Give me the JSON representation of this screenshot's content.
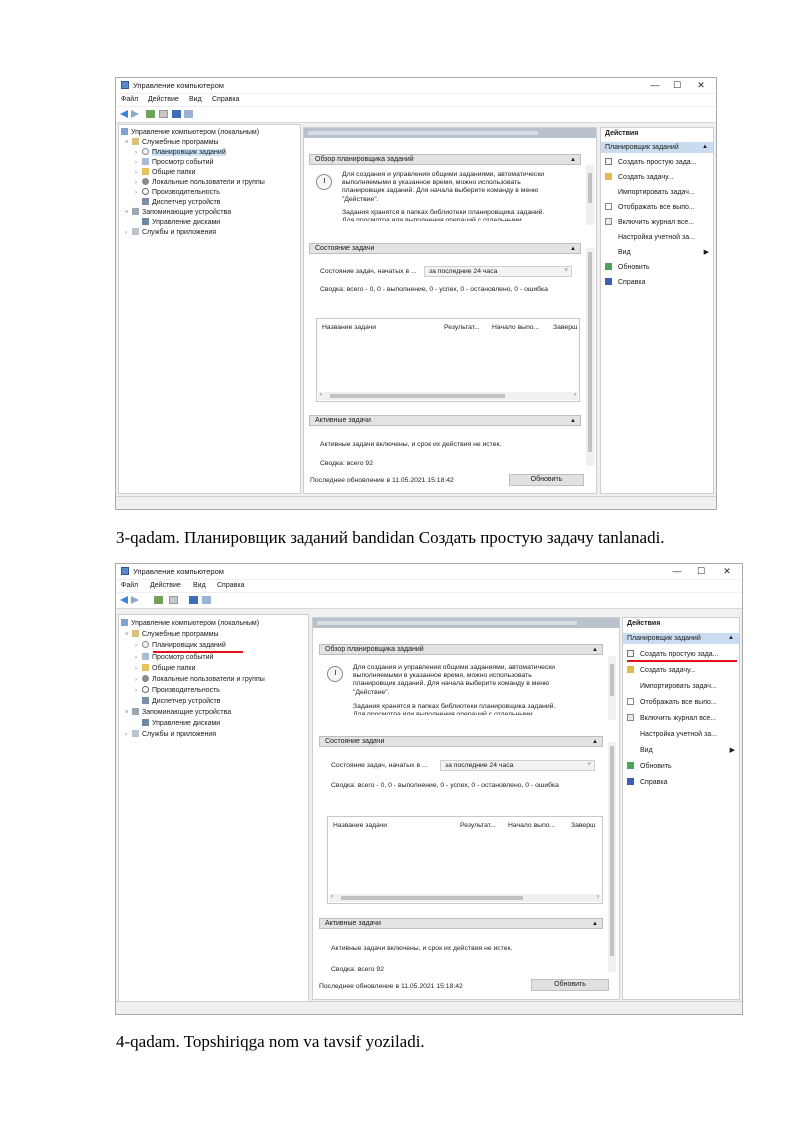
{
  "captions": {
    "step3": "3-qadam. Планировщик заданий bandidan Создать простую задачу tanlanadi.",
    "step4": "4-qadam. Topshiriqga nom va tavsif yoziladi."
  },
  "window": {
    "title": "Управление компьютером",
    "controls": {
      "minimize": "—",
      "maximize": "☐",
      "close": "✕"
    },
    "menu": [
      "Файл",
      "Действие",
      "Вид",
      "Справка"
    ],
    "tree": [
      {
        "label": "Управление компьютером (локальным)",
        "level": 0
      },
      {
        "label": "Служебные программы",
        "level": 1
      },
      {
        "label": "Планировщик заданий",
        "level": 2,
        "selected": true
      },
      {
        "label": "Просмотр событий",
        "level": 2
      },
      {
        "label": "Общие папки",
        "level": 2
      },
      {
        "label": "Локальные пользователи и группы",
        "level": 2
      },
      {
        "label": "Производительность",
        "level": 2
      },
      {
        "label": "Диспетчер устройств",
        "level": 2
      },
      {
        "label": "Запоминающие устройства",
        "level": 1
      },
      {
        "label": "Управление дисками",
        "level": 2
      },
      {
        "label": "Службы и приложения",
        "level": 1
      }
    ],
    "overview": {
      "header": "Обзор планировщика заданий",
      "line1": "Для создания и управления общими заданиями, автоматически",
      "line2": "выполняемыми в указанное время, можно использовать",
      "line3": "планировщик заданий. Для начала выберите команду в меню",
      "line4": "\"Действие\".",
      "line5": "Задания хранятся в папках библиотеки планировщика заданий.",
      "line6": "Для просмотра или выполнения операций с отдельными"
    },
    "status": {
      "header": "Состояние задачи",
      "state_label": "Состояние задач, начатых в ...",
      "period": "за последние 24 часа",
      "summary": "Сводка: всего - 0, 0 - выполнение, 0 - успех, 0 - остановлено, 0 - ошибка",
      "columns": [
        "Название задачи",
        "Результат...",
        "Начало выпо...",
        "Заверш"
      ]
    },
    "active": {
      "header": "Активные задачи",
      "text": "Активные задачи включены, и срок их действия не истек.",
      "count": "Сводка: всего 92"
    },
    "last_update": "Последнее обновление в 11.05.2021 15:18:42",
    "refresh_button": "Обновить",
    "actions": {
      "title": "Действия",
      "subheader": "Планировщик заданий",
      "items": [
        "Создать простую зада...",
        "Создать задачу...",
        "Импортировать задач...",
        "Отображать все выпо...",
        "Включить журнал все...",
        "Настройка учетной за...",
        "Вид",
        "Обновить",
        "Справка"
      ]
    }
  },
  "colors": {
    "highlight": "#cce4f7",
    "action_header": "#c9dcef",
    "red_underline": "#e3131b"
  }
}
